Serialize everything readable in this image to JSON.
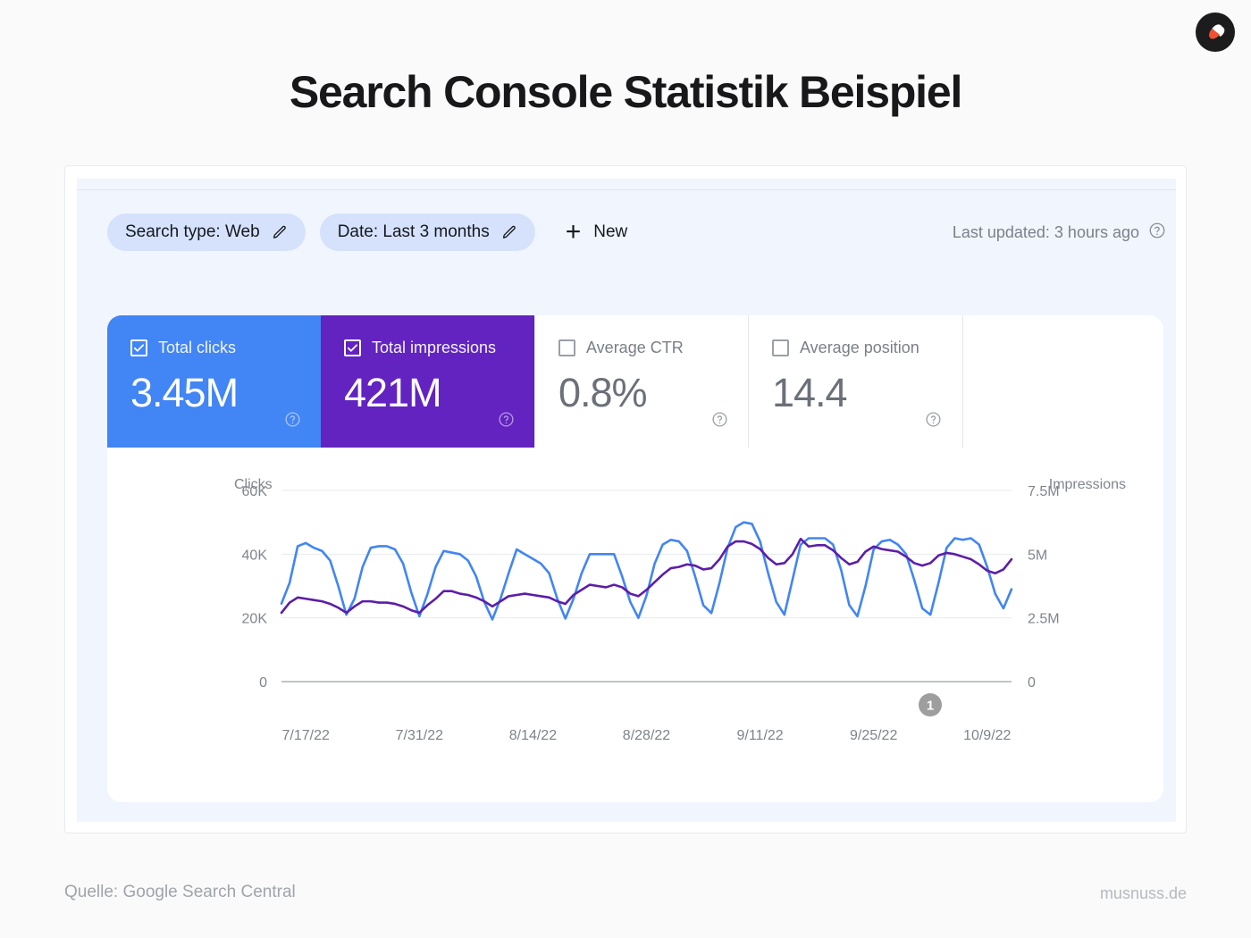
{
  "page": {
    "title": "Search Console Statistik Beispiel",
    "footer_source": "Quelle: Google Search Central",
    "footer_site": "musnuss.de",
    "logo_name": "acorn-logo"
  },
  "toolbar": {
    "chips": [
      {
        "label": "Search type: Web",
        "icon": "pencil-icon"
      },
      {
        "label": "Date: Last 3 months",
        "icon": "pencil-icon"
      }
    ],
    "new_label": "New",
    "plus_glyph": "+",
    "last_updated": "Last updated: 3 hours ago",
    "help_icon": "question-circle-icon"
  },
  "metrics": [
    {
      "label": "Total clicks",
      "value": "3.45M",
      "checked": true,
      "color": "#4285f4",
      "text_color": "#ffffff"
    },
    {
      "label": "Total impressions",
      "value": "421M",
      "checked": true,
      "color": "#6223c0",
      "text_color": "#ffffff"
    },
    {
      "label": "Average CTR",
      "value": "0.8%",
      "checked": false,
      "color": "#ffffff",
      "text_color": "#6b7079"
    },
    {
      "label": "Average position",
      "value": "14.4",
      "checked": false,
      "color": "#ffffff",
      "text_color": "#6b7079"
    }
  ],
  "annotation_badge": "1",
  "chart_data": {
    "type": "line",
    "title": "",
    "xlabel": "",
    "ylabel": "Clicks",
    "y2label": "Impressions",
    "grid": true,
    "legend": "none",
    "ylim": [
      0,
      60000
    ],
    "y2lim": [
      0,
      7500000
    ],
    "yticks": [
      0,
      20000,
      40000,
      60000
    ],
    "ytick_labels": [
      "0",
      "20K",
      "40K",
      "60K"
    ],
    "y2ticks": [
      0,
      2500000,
      5000000,
      7500000
    ],
    "y2tick_labels": [
      "0",
      "2.5M",
      "5M",
      "7.5M"
    ],
    "xtick_labels": [
      "7/17/22",
      "7/31/22",
      "8/14/22",
      "8/28/22",
      "9/11/22",
      "9/25/22",
      "10/9/22"
    ],
    "xtick_indices": [
      3,
      17,
      31,
      45,
      59,
      73,
      87
    ],
    "x_start": "7/14/22",
    "x_end": "10/15/22",
    "series": [
      {
        "name": "Total clicks",
        "color": "#4285f4",
        "axis": "left",
        "unit": "clicks",
        "values": [
          24500,
          31000,
          42500,
          43500,
          42000,
          41000,
          38000,
          30000,
          21000,
          26000,
          36000,
          42000,
          42500,
          42500,
          41500,
          37000,
          28000,
          20500,
          27500,
          36000,
          41000,
          40500,
          40000,
          38000,
          33000,
          25000,
          19500,
          26000,
          34000,
          41500,
          40000,
          38500,
          37000,
          34000,
          26000,
          19800,
          26000,
          34000,
          40000,
          40000,
          40000,
          40000,
          33000,
          25000,
          20000,
          27000,
          37000,
          43000,
          44500,
          44000,
          41000,
          33000,
          24000,
          21500,
          31000,
          42000,
          48500,
          50000,
          49500,
          44000,
          34000,
          25000,
          21000,
          32000,
          43000,
          45000,
          45000,
          45000,
          43000,
          35000,
          24000,
          20500,
          30000,
          41500,
          44000,
          44500,
          43000,
          40000,
          32000,
          23000,
          21000,
          31000,
          42000,
          45000,
          44500,
          45000,
          43000,
          36000,
          27500,
          23000,
          29000
        ]
      },
      {
        "name": "Total impressions",
        "color": "#5c1ea8",
        "axis": "right",
        "unit": "impressions",
        "values": [
          2700000,
          3100000,
          3300000,
          3250000,
          3200000,
          3150000,
          3050000,
          2900000,
          2700000,
          2950000,
          3150000,
          3150000,
          3100000,
          3100000,
          3050000,
          2950000,
          2800000,
          2700000,
          3000000,
          3250000,
          3550000,
          3550000,
          3450000,
          3400000,
          3300000,
          3150000,
          2950000,
          3150000,
          3350000,
          3400000,
          3450000,
          3400000,
          3350000,
          3300000,
          3150000,
          3050000,
          3400000,
          3600000,
          3800000,
          3750000,
          3700000,
          3800000,
          3700000,
          3450000,
          3350000,
          3600000,
          3900000,
          4200000,
          4450000,
          4500000,
          4600000,
          4550000,
          4400000,
          4450000,
          4800000,
          5300000,
          5500000,
          5500000,
          5400000,
          5200000,
          4850000,
          4600000,
          4650000,
          5000000,
          5600000,
          5300000,
          5350000,
          5350000,
          5150000,
          4850000,
          4600000,
          4700000,
          5100000,
          5300000,
          5200000,
          5150000,
          5100000,
          4900000,
          4650000,
          4550000,
          4650000,
          4950000,
          5050000,
          5000000,
          4900000,
          4800000,
          4600000,
          4350000,
          4250000,
          4400000,
          4800000
        ]
      }
    ]
  }
}
